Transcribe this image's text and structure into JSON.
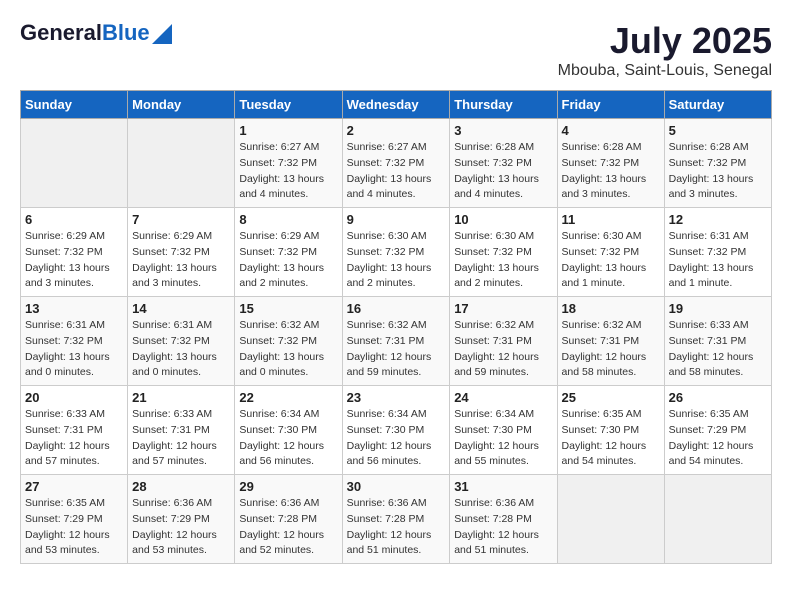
{
  "header": {
    "logo_general": "General",
    "logo_blue": "Blue",
    "title": "July 2025",
    "subtitle": "Mbouba, Saint-Louis, Senegal"
  },
  "weekdays": [
    "Sunday",
    "Monday",
    "Tuesday",
    "Wednesday",
    "Thursday",
    "Friday",
    "Saturday"
  ],
  "weeks": [
    [
      {
        "day": "",
        "info": ""
      },
      {
        "day": "",
        "info": ""
      },
      {
        "day": "1",
        "info": "Sunrise: 6:27 AM\nSunset: 7:32 PM\nDaylight: 13 hours and 4 minutes."
      },
      {
        "day": "2",
        "info": "Sunrise: 6:27 AM\nSunset: 7:32 PM\nDaylight: 13 hours and 4 minutes."
      },
      {
        "day": "3",
        "info": "Sunrise: 6:28 AM\nSunset: 7:32 PM\nDaylight: 13 hours and 4 minutes."
      },
      {
        "day": "4",
        "info": "Sunrise: 6:28 AM\nSunset: 7:32 PM\nDaylight: 13 hours and 3 minutes."
      },
      {
        "day": "5",
        "info": "Sunrise: 6:28 AM\nSunset: 7:32 PM\nDaylight: 13 hours and 3 minutes."
      }
    ],
    [
      {
        "day": "6",
        "info": "Sunrise: 6:29 AM\nSunset: 7:32 PM\nDaylight: 13 hours and 3 minutes."
      },
      {
        "day": "7",
        "info": "Sunrise: 6:29 AM\nSunset: 7:32 PM\nDaylight: 13 hours and 3 minutes."
      },
      {
        "day": "8",
        "info": "Sunrise: 6:29 AM\nSunset: 7:32 PM\nDaylight: 13 hours and 2 minutes."
      },
      {
        "day": "9",
        "info": "Sunrise: 6:30 AM\nSunset: 7:32 PM\nDaylight: 13 hours and 2 minutes."
      },
      {
        "day": "10",
        "info": "Sunrise: 6:30 AM\nSunset: 7:32 PM\nDaylight: 13 hours and 2 minutes."
      },
      {
        "day": "11",
        "info": "Sunrise: 6:30 AM\nSunset: 7:32 PM\nDaylight: 13 hours and 1 minute."
      },
      {
        "day": "12",
        "info": "Sunrise: 6:31 AM\nSunset: 7:32 PM\nDaylight: 13 hours and 1 minute."
      }
    ],
    [
      {
        "day": "13",
        "info": "Sunrise: 6:31 AM\nSunset: 7:32 PM\nDaylight: 13 hours and 0 minutes."
      },
      {
        "day": "14",
        "info": "Sunrise: 6:31 AM\nSunset: 7:32 PM\nDaylight: 13 hours and 0 minutes."
      },
      {
        "day": "15",
        "info": "Sunrise: 6:32 AM\nSunset: 7:32 PM\nDaylight: 13 hours and 0 minutes."
      },
      {
        "day": "16",
        "info": "Sunrise: 6:32 AM\nSunset: 7:31 PM\nDaylight: 12 hours and 59 minutes."
      },
      {
        "day": "17",
        "info": "Sunrise: 6:32 AM\nSunset: 7:31 PM\nDaylight: 12 hours and 59 minutes."
      },
      {
        "day": "18",
        "info": "Sunrise: 6:32 AM\nSunset: 7:31 PM\nDaylight: 12 hours and 58 minutes."
      },
      {
        "day": "19",
        "info": "Sunrise: 6:33 AM\nSunset: 7:31 PM\nDaylight: 12 hours and 58 minutes."
      }
    ],
    [
      {
        "day": "20",
        "info": "Sunrise: 6:33 AM\nSunset: 7:31 PM\nDaylight: 12 hours and 57 minutes."
      },
      {
        "day": "21",
        "info": "Sunrise: 6:33 AM\nSunset: 7:31 PM\nDaylight: 12 hours and 57 minutes."
      },
      {
        "day": "22",
        "info": "Sunrise: 6:34 AM\nSunset: 7:30 PM\nDaylight: 12 hours and 56 minutes."
      },
      {
        "day": "23",
        "info": "Sunrise: 6:34 AM\nSunset: 7:30 PM\nDaylight: 12 hours and 56 minutes."
      },
      {
        "day": "24",
        "info": "Sunrise: 6:34 AM\nSunset: 7:30 PM\nDaylight: 12 hours and 55 minutes."
      },
      {
        "day": "25",
        "info": "Sunrise: 6:35 AM\nSunset: 7:30 PM\nDaylight: 12 hours and 54 minutes."
      },
      {
        "day": "26",
        "info": "Sunrise: 6:35 AM\nSunset: 7:29 PM\nDaylight: 12 hours and 54 minutes."
      }
    ],
    [
      {
        "day": "27",
        "info": "Sunrise: 6:35 AM\nSunset: 7:29 PM\nDaylight: 12 hours and 53 minutes."
      },
      {
        "day": "28",
        "info": "Sunrise: 6:36 AM\nSunset: 7:29 PM\nDaylight: 12 hours and 53 minutes."
      },
      {
        "day": "29",
        "info": "Sunrise: 6:36 AM\nSunset: 7:28 PM\nDaylight: 12 hours and 52 minutes."
      },
      {
        "day": "30",
        "info": "Sunrise: 6:36 AM\nSunset: 7:28 PM\nDaylight: 12 hours and 51 minutes."
      },
      {
        "day": "31",
        "info": "Sunrise: 6:36 AM\nSunset: 7:28 PM\nDaylight: 12 hours and 51 minutes."
      },
      {
        "day": "",
        "info": ""
      },
      {
        "day": "",
        "info": ""
      }
    ]
  ]
}
